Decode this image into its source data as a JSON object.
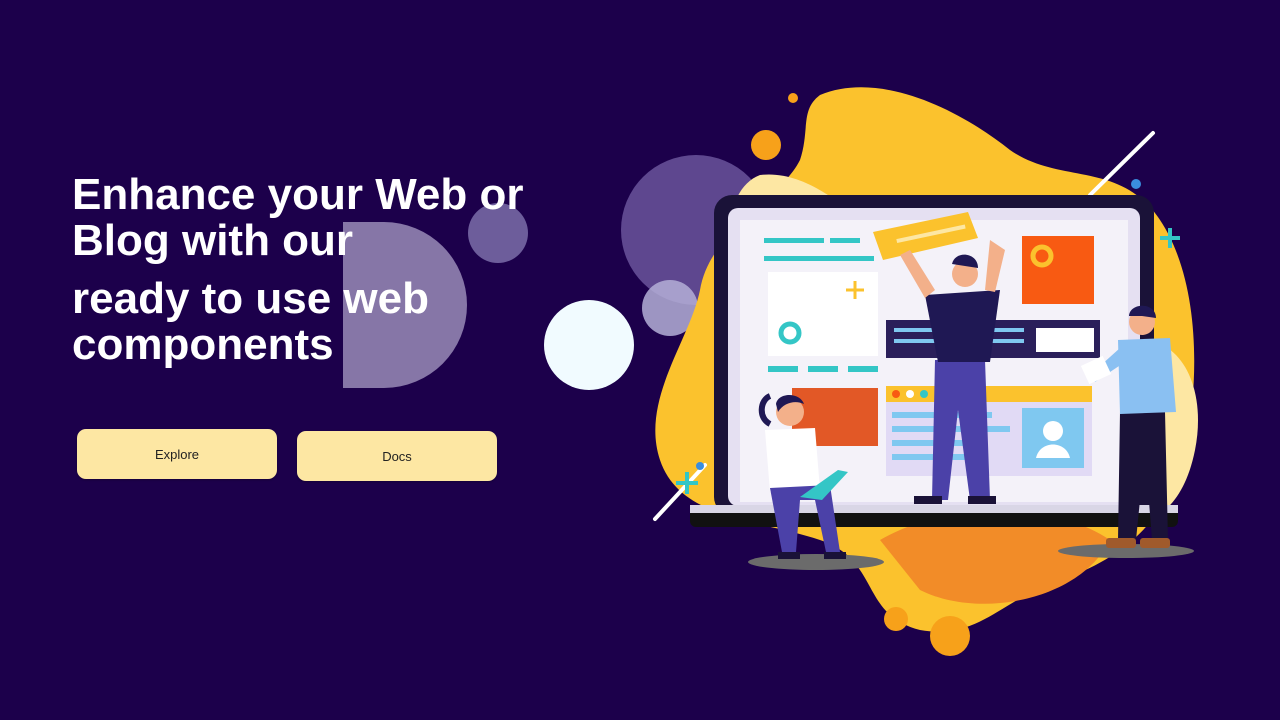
{
  "hero": {
    "headline_lines": [
      "Enhance your Web or",
      "Blog with our",
      "ready to use web",
      "components"
    ],
    "buttons": {
      "explore_label": "Explore",
      "docs_label": "Docs"
    }
  },
  "illustration": {
    "icon": "web-developers-illustration"
  },
  "colors": {
    "background": "#1c004b",
    "button": "#fde7a3",
    "accent_yellow": "#fbc22d",
    "accent_orange": "#f28c28"
  }
}
